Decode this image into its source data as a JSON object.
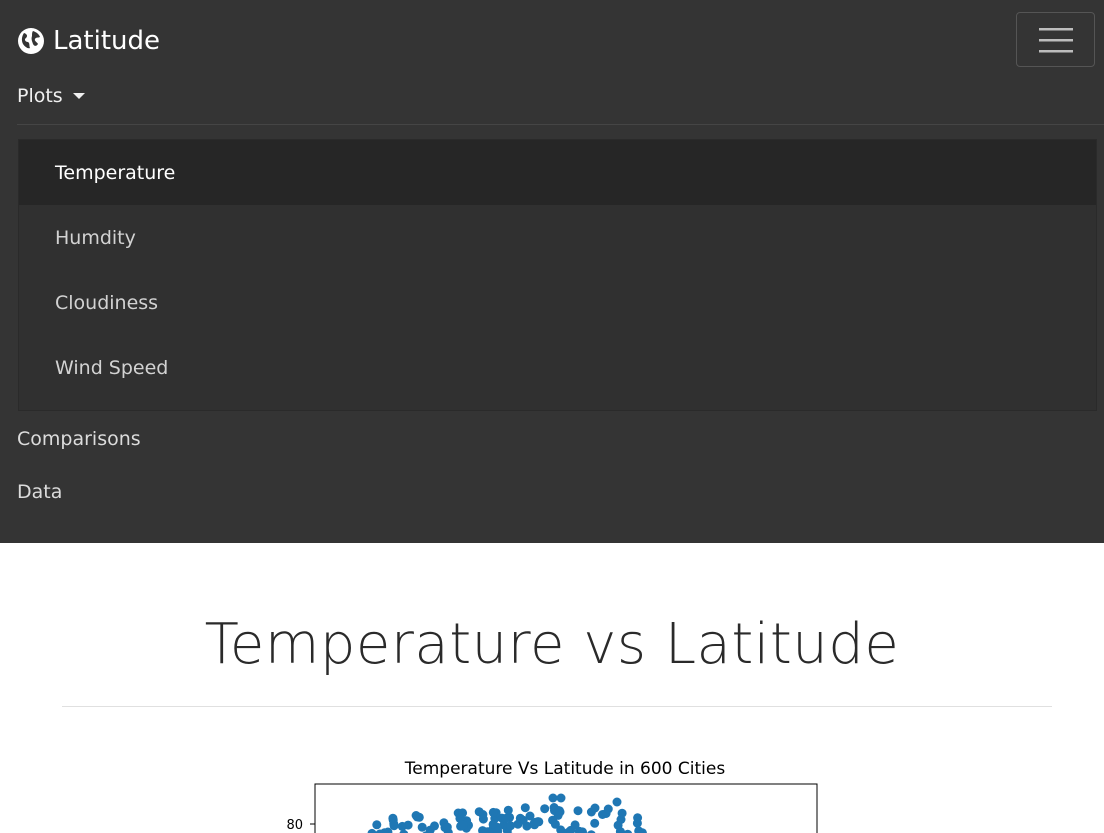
{
  "navbar": {
    "brand": "Latitude",
    "brand_icon": "globe-icon",
    "toggler_icon": "hamburger-icon",
    "plots_label": "Plots",
    "dropdown_items": [
      {
        "label": "Temperature",
        "active": true
      },
      {
        "label": "Humdity",
        "active": false
      },
      {
        "label": "Cloudiness",
        "active": false
      },
      {
        "label": "Wind Speed",
        "active": false
      }
    ],
    "comparisons_label": "Comparisons",
    "data_label": "Data"
  },
  "main": {
    "heading": "Temperature vs Latitude"
  },
  "chart_data": {
    "type": "scatter",
    "title": "Temperature Vs Latitude in 600 Cities",
    "ytick_labels": [
      "80"
    ],
    "color": "#1f77b4"
  }
}
